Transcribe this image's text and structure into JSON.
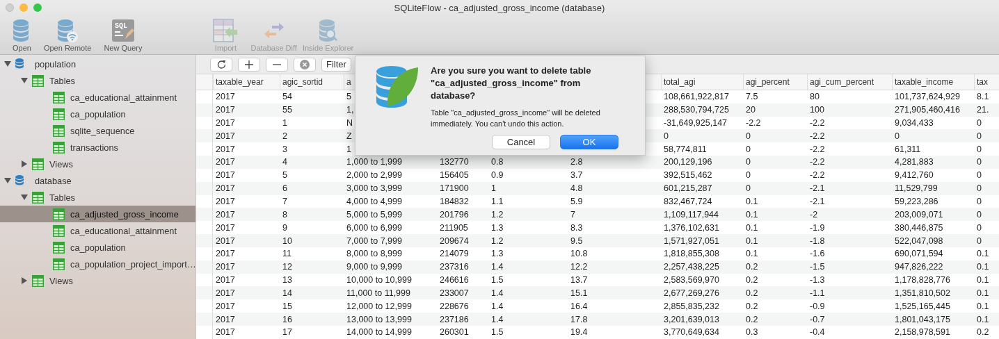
{
  "window": {
    "title": "SQLiteFlow  -  ca_adjusted_gross_income (database)"
  },
  "toolbar": [
    {
      "label": "Open",
      "kind": "database",
      "disabled": false
    },
    {
      "label": "Open Remote",
      "kind": "remote",
      "disabled": false
    },
    {
      "label": "New Query",
      "kind": "query",
      "icon_text": "SQL",
      "disabled": false
    },
    {
      "label": "Import",
      "kind": "import",
      "disabled": true
    },
    {
      "label": "Database Diff",
      "kind": "diff",
      "disabled": true
    },
    {
      "label": "Inside Explorer",
      "kind": "explorer",
      "disabled": true
    }
  ],
  "sidebar": {
    "items": [
      {
        "label": "population",
        "kind": "database",
        "expanded": true,
        "children": [
          {
            "label": "Tables",
            "kind": "group",
            "expanded": true,
            "children": [
              {
                "label": "ca_educational_attainment",
                "kind": "table",
                "selected": false
              },
              {
                "label": "ca_population",
                "kind": "table",
                "selected": false
              },
              {
                "label": "sqlite_sequence",
                "kind": "table",
                "selected": false
              },
              {
                "label": "transactions",
                "kind": "table",
                "selected": false
              }
            ]
          },
          {
            "label": "Views",
            "kind": "group",
            "expanded": false
          }
        ]
      },
      {
        "label": "database",
        "kind": "database",
        "expanded": true,
        "children": [
          {
            "label": "Tables",
            "kind": "group",
            "expanded": true,
            "children": [
              {
                "label": "ca_adjusted_gross_income",
                "kind": "table",
                "selected": true
              },
              {
                "label": "ca_educational_attainment",
                "kind": "table",
                "selected": false
              },
              {
                "label": "ca_population",
                "kind": "table",
                "selected": false
              },
              {
                "label": "ca_population_project_import…",
                "kind": "table",
                "selected": false
              }
            ]
          },
          {
            "label": "Views",
            "kind": "group",
            "expanded": false
          }
        ]
      }
    ]
  },
  "table_toolbar": {
    "buttons": [
      {
        "kind": "refresh"
      },
      {
        "kind": "add"
      },
      {
        "kind": "remove"
      },
      {
        "kind": "clear"
      },
      {
        "kind": "text",
        "label": "Filter"
      }
    ]
  },
  "table": {
    "columns": [
      "taxable_year",
      "agic_sortid",
      "a",
      null,
      null,
      null,
      "total_agi",
      "agi_percent",
      "agi_cum_percent",
      "taxable_income",
      "tax"
    ],
    "rows": [
      [
        "2017",
        "54",
        "5",
        null,
        null,
        null,
        "108,661,922,817",
        "7.5",
        "80",
        "101,737,624,929",
        "8.1"
      ],
      [
        "2017",
        "55",
        "1,",
        null,
        null,
        null,
        "288,530,794,725",
        "20",
        "100",
        "271,905,460,416",
        "21."
      ],
      [
        "2017",
        "1",
        "N",
        null,
        null,
        null,
        "-31,649,925,147",
        "-2.2",
        "-2.2",
        "9,034,433",
        "0"
      ],
      [
        "2017",
        "2",
        "Z",
        null,
        null,
        null,
        "0",
        "0",
        "-2.2",
        "0",
        "0"
      ],
      [
        "2017",
        "3",
        "1",
        null,
        null,
        null,
        "58,774,811",
        "0",
        "-2.2",
        "61,311",
        "0"
      ],
      [
        "2017",
        "4",
        "1,000 to 1,999",
        "132770",
        "0.8",
        "2.8",
        "200,129,196",
        "0",
        "-2.2",
        "4,281,883",
        "0"
      ],
      [
        "2017",
        "5",
        "2,000 to 2,999",
        "156405",
        "0.9",
        "3.7",
        "392,515,462",
        "0",
        "-2.2",
        "9,412,760",
        "0"
      ],
      [
        "2017",
        "6",
        "3,000 to 3,999",
        "171900",
        "1",
        "4.8",
        "601,215,287",
        "0",
        "-2.1",
        "11,529,799",
        "0"
      ],
      [
        "2017",
        "7",
        "4,000 to 4,999",
        "184832",
        "1.1",
        "5.9",
        "832,467,724",
        "0.1",
        "-2.1",
        "59,223,286",
        "0"
      ],
      [
        "2017",
        "8",
        "5,000 to 5,999",
        "201796",
        "1.2",
        "7",
        "1,109,117,944",
        "0.1",
        "-2",
        "203,009,071",
        "0"
      ],
      [
        "2017",
        "9",
        "6,000 to 6,999",
        "211905",
        "1.3",
        "8.3",
        "1,376,102,631",
        "0.1",
        "-1.9",
        "380,446,875",
        "0"
      ],
      [
        "2017",
        "10",
        "7,000 to 7,999",
        "209674",
        "1.2",
        "9.5",
        "1,571,927,051",
        "0.1",
        "-1.8",
        "522,047,098",
        "0"
      ],
      [
        "2017",
        "11",
        "8,000 to 8,999",
        "214079",
        "1.3",
        "10.8",
        "1,818,855,308",
        "0.1",
        "-1.6",
        "690,071,594",
        "0.1"
      ],
      [
        "2017",
        "12",
        "9,000 to 9,999",
        "237316",
        "1.4",
        "12.2",
        "2,257,438,225",
        "0.2",
        "-1.5",
        "947,826,222",
        "0.1"
      ],
      [
        "2017",
        "13",
        "10,000 to 10,999",
        "246616",
        "1.5",
        "13.7",
        "2,583,569,970",
        "0.2",
        "-1.3",
        "1,178,828,776",
        "0.1"
      ],
      [
        "2017",
        "14",
        "11,000 to 11,999",
        "233007",
        "1.4",
        "15.1",
        "2,677,269,276",
        "0.2",
        "-1.1",
        "1,351,810,502",
        "0.1"
      ],
      [
        "2017",
        "15",
        "12,000 to 12,999",
        "228676",
        "1.4",
        "16.4",
        "2,855,835,232",
        "0.2",
        "-0.9",
        "1,525,165,445",
        "0.1"
      ],
      [
        "2017",
        "16",
        "13,000 to 13,999",
        "237186",
        "1.4",
        "17.8",
        "3,201,639,013",
        "0.2",
        "-0.7",
        "1,801,043,175",
        "0.1"
      ],
      [
        "2017",
        "17",
        "14,000 to 14,999",
        "260301",
        "1.5",
        "19.4",
        "3,770,649,634",
        "0.3",
        "-0.4",
        "2,158,978,591",
        "0.2"
      ]
    ]
  },
  "dialog": {
    "title": "Are you sure you want to delete table \"ca_adjusted_gross_income\" from database?",
    "message": "Table \"ca_adjusted_gross_income\" will be deleted immediately. You can't undo this action.",
    "buttons": [
      {
        "label": "Cancel",
        "kind": "cancel"
      },
      {
        "label": "OK",
        "kind": "default"
      }
    ]
  }
}
